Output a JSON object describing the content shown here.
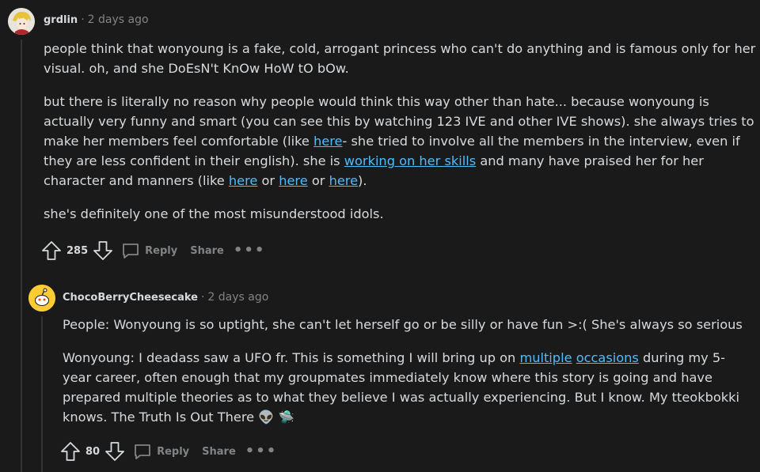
{
  "comments": [
    {
      "username": "grdlin",
      "separator": "·",
      "time": "2 days ago",
      "paragraphs": [
        [
          {
            "text": "people think that wonyoung is a fake, cold, arrogant princess who can't do anything and is famous only for her visual. oh, and she DoEsN't KnOw HoW tO bOw."
          }
        ],
        [
          {
            "text": "but there is literally no reason why people would think this way other than hate... because wonyoung is actually very funny and smart (you can see this by watching 123 IVE and other IVE shows). she always tries to make her members feel comfortable (like "
          },
          {
            "text": "here",
            "link": true
          },
          {
            "text": "- she tried to involve all the members in the interview, even if they are less confident in their english). she is "
          },
          {
            "text": "working on her skills",
            "link": true
          },
          {
            "text": " and many have praised her for her character and manners (like "
          },
          {
            "text": "here",
            "link": true
          },
          {
            "text": " or "
          },
          {
            "text": "here",
            "link": true
          },
          {
            "text": " or "
          },
          {
            "text": "here",
            "link": true
          },
          {
            "text": ")."
          }
        ],
        [
          {
            "text": "she's definitely one of the most misunderstood idols."
          }
        ]
      ],
      "score": "285",
      "reply_label": "Reply",
      "share_label": "Share",
      "more_label": "•••"
    },
    {
      "username": "ChocoBerryCheesecake",
      "separator": "·",
      "time": "2 days ago",
      "paragraphs": [
        [
          {
            "text": "People: Wonyoung is so uptight, she can't let herself go or be silly or have fun >:( She's always so serious"
          }
        ],
        [
          {
            "text": "Wonyoung: I deadass saw a UFO fr. This is something I will bring up on "
          },
          {
            "text": "multiple",
            "link": true
          },
          {
            "text": " "
          },
          {
            "text": "occasions",
            "link": true
          },
          {
            "text": " during my 5-year career, often enough that my groupmates immediately know where this story is going and have prepared multiple theories as to what they believe I was actually experiencing. But I know. My tteokbokki knows. The Truth Is Out There 👽 🛸"
          }
        ]
      ],
      "score": "80",
      "reply_label": "Reply",
      "share_label": "Share",
      "more_label": "•••"
    }
  ],
  "colors": {
    "background": "#1a1a1b",
    "text": "#d7dadc",
    "muted": "#818384",
    "link": "#4fbcff",
    "thread_line": "#343536"
  },
  "icons": {
    "upvote": "arrow-up-icon",
    "downvote": "arrow-down-icon",
    "reply": "speech-bubble-icon",
    "more": "more-options-icon"
  }
}
